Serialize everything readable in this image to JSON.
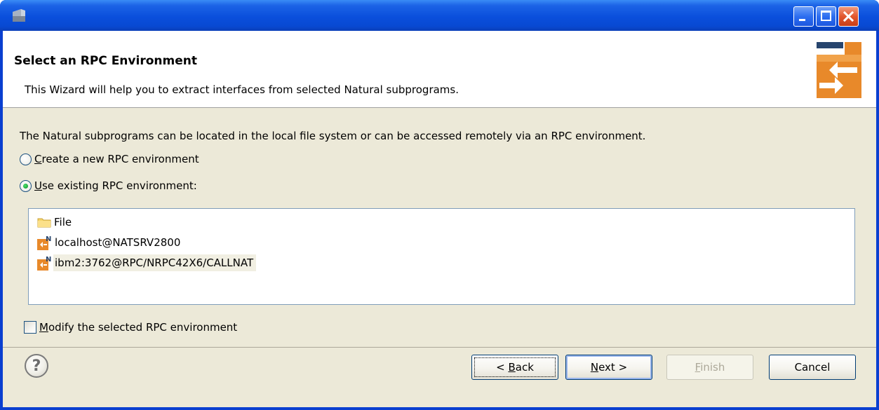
{
  "window": {
    "title": "",
    "controls": {
      "minimize": "minimize",
      "maximize": "maximize",
      "close": "close"
    }
  },
  "banner": {
    "title": "Select an RPC Environment",
    "description": "This Wizard will help you to extract interfaces from selected Natural subprograms."
  },
  "body": {
    "intro": "The Natural subprograms can be located in the local file system or can be accessed remotely via an RPC environment.",
    "radio_create": {
      "mnemonic": "C",
      "rest": "reate a new RPC environment",
      "checked": false
    },
    "radio_existing": {
      "mnemonic": "U",
      "rest": "se existing RPC environment:",
      "checked": true
    },
    "environments": [
      {
        "label": "File",
        "icon": "folder-icon"
      },
      {
        "label": "localhost@NATSRV2800",
        "icon": "natural-rpc-icon"
      },
      {
        "label": "ibm2:3762@RPC/NRPC42X6/CALLNAT",
        "icon": "natural-rpc-icon",
        "selected": true
      }
    ],
    "modify_checkbox": {
      "mnemonic": "M",
      "rest": "odify the selected RPC environment",
      "checked": false
    }
  },
  "footer": {
    "back": {
      "prefix": "< ",
      "mnemonic": "B",
      "rest": "ack"
    },
    "next": {
      "mnemonic": "N",
      "rest": "ext >"
    },
    "finish": {
      "mnemonic": "F",
      "rest": "inish"
    },
    "cancel": "Cancel"
  },
  "colors": {
    "titlebar": "#0a4fdc",
    "dialog_bg": "#ece9d8",
    "accent_orange": "#e8892a",
    "selection": "#f1efe2"
  }
}
